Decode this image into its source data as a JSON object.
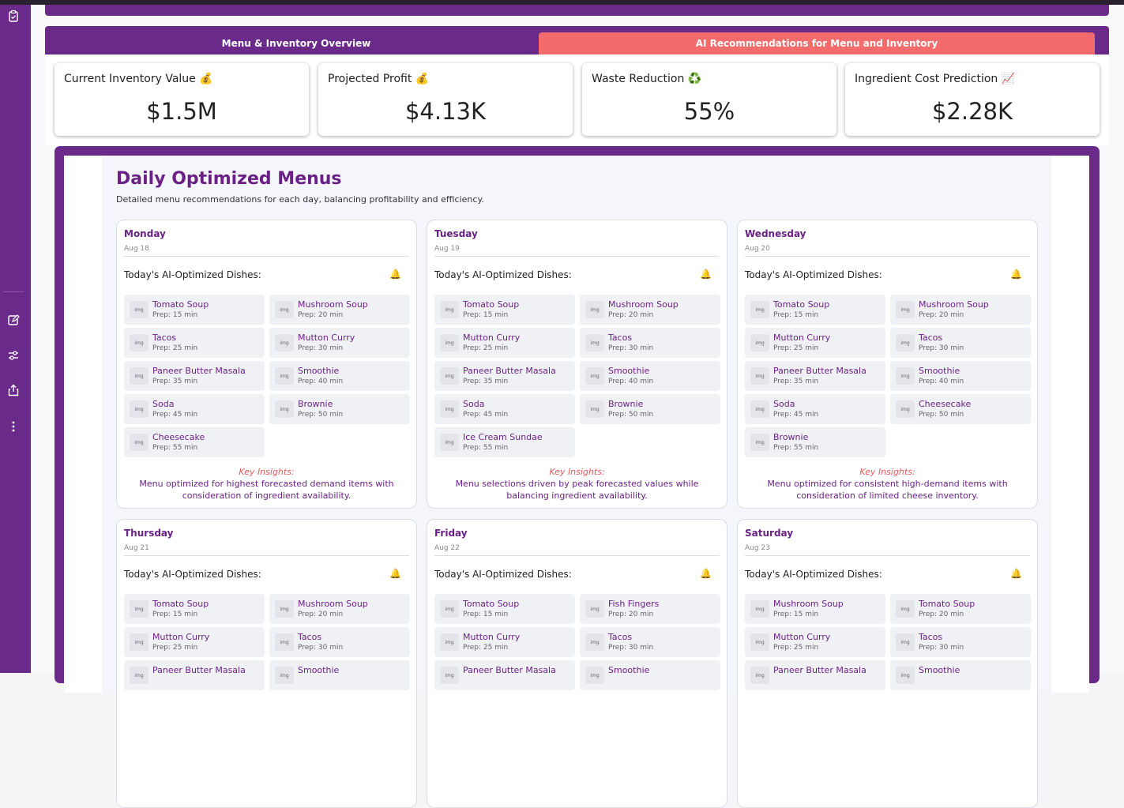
{
  "tabs": [
    {
      "label": "Menu & Inventory Overview"
    },
    {
      "label": "AI Recommendations for Menu and Inventory"
    }
  ],
  "kpis": [
    {
      "title": "Current Inventory Value 💰",
      "value": "$1.5M"
    },
    {
      "title": "Projected Profit 💰",
      "value": "$4.13K"
    },
    {
      "title": "Waste Reduction ♻️",
      "value": "55%"
    },
    {
      "title": "Ingredient Cost Prediction 📈",
      "value": "$2.28K"
    }
  ],
  "section": {
    "title": "Daily Optimized Menus",
    "subtitle": "Detailed menu recommendations for each day, balancing profitability and efficiency.",
    "dishes_heading": "Today's AI-Optimized Dishes:",
    "insights_heading": "Key Insights:",
    "dish_icon": "img",
    "bell_icon": "🔔"
  },
  "days": [
    {
      "day": "Monday",
      "date": "Aug 18",
      "dishes": [
        {
          "name": "Tomato Soup",
          "prep": "Prep: 15 min"
        },
        {
          "name": "Mushroom Soup",
          "prep": "Prep: 20 min"
        },
        {
          "name": "Tacos",
          "prep": "Prep: 25 min"
        },
        {
          "name": "Mutton Curry",
          "prep": "Prep: 30 min"
        },
        {
          "name": "Paneer Butter Masala",
          "prep": "Prep: 35 min"
        },
        {
          "name": "Smoothie",
          "prep": "Prep: 40 min"
        },
        {
          "name": "Soda",
          "prep": "Prep: 45 min"
        },
        {
          "name": "Brownie",
          "prep": "Prep: 50 min"
        },
        {
          "name": "Cheesecake",
          "prep": "Prep: 55 min"
        }
      ],
      "insight": "Menu optimized for highest forecasted demand items with consideration of ingredient availability."
    },
    {
      "day": "Tuesday",
      "date": "Aug 19",
      "dishes": [
        {
          "name": "Tomato Soup",
          "prep": "Prep: 15 min"
        },
        {
          "name": "Mushroom Soup",
          "prep": "Prep: 20 min"
        },
        {
          "name": "Mutton Curry",
          "prep": "Prep: 25 min"
        },
        {
          "name": "Tacos",
          "prep": "Prep: 30 min"
        },
        {
          "name": "Paneer Butter Masala",
          "prep": "Prep: 35 min"
        },
        {
          "name": "Smoothie",
          "prep": "Prep: 40 min"
        },
        {
          "name": "Soda",
          "prep": "Prep: 45 min"
        },
        {
          "name": "Brownie",
          "prep": "Prep: 50 min"
        },
        {
          "name": "Ice Cream Sundae",
          "prep": "Prep: 55 min"
        }
      ],
      "insight": "Menu selections driven by peak forecasted values while balancing ingredient availability."
    },
    {
      "day": "Wednesday",
      "date": "Aug 20",
      "dishes": [
        {
          "name": "Tomato Soup",
          "prep": "Prep: 15 min"
        },
        {
          "name": "Mushroom Soup",
          "prep": "Prep: 20 min"
        },
        {
          "name": "Mutton Curry",
          "prep": "Prep: 25 min"
        },
        {
          "name": "Tacos",
          "prep": "Prep: 30 min"
        },
        {
          "name": "Paneer Butter Masala",
          "prep": "Prep: 35 min"
        },
        {
          "name": "Smoothie",
          "prep": "Prep: 40 min"
        },
        {
          "name": "Soda",
          "prep": "Prep: 45 min"
        },
        {
          "name": "Cheesecake",
          "prep": "Prep: 50 min"
        },
        {
          "name": "Brownie",
          "prep": "Prep: 55 min"
        }
      ],
      "insight": "Menu optimized for consistent high-demand items with consideration of limited cheese inventory."
    },
    {
      "day": "Thursday",
      "date": "Aug 21",
      "dishes": [
        {
          "name": "Tomato Soup",
          "prep": "Prep: 15 min"
        },
        {
          "name": "Mushroom Soup",
          "prep": "Prep: 20 min"
        },
        {
          "name": "Mutton Curry",
          "prep": "Prep: 25 min"
        },
        {
          "name": "Tacos",
          "prep": "Prep: 30 min"
        },
        {
          "name": "Paneer Butter Masala",
          "prep": ""
        },
        {
          "name": "Smoothie",
          "prep": ""
        }
      ],
      "insight": ""
    },
    {
      "day": "Friday",
      "date": "Aug 22",
      "dishes": [
        {
          "name": "Tomato Soup",
          "prep": "Prep: 15 min"
        },
        {
          "name": "Fish Fingers",
          "prep": "Prep: 20 min"
        },
        {
          "name": "Mutton Curry",
          "prep": "Prep: 25 min"
        },
        {
          "name": "Tacos",
          "prep": "Prep: 30 min"
        },
        {
          "name": "Paneer Butter Masala",
          "prep": ""
        },
        {
          "name": "Smoothie",
          "prep": ""
        }
      ],
      "insight": ""
    },
    {
      "day": "Saturday",
      "date": "Aug 23",
      "dishes": [
        {
          "name": "Mushroom Soup",
          "prep": "Prep: 15 min"
        },
        {
          "name": "Tomato Soup",
          "prep": "Prep: 20 min"
        },
        {
          "name": "Mutton Curry",
          "prep": "Prep: 25 min"
        },
        {
          "name": "Tacos",
          "prep": "Prep: 30 min"
        },
        {
          "name": "Paneer Butter Masala",
          "prep": ""
        },
        {
          "name": "Smoothie",
          "prep": ""
        }
      ],
      "insight": ""
    }
  ],
  "sidebar": {
    "icons": [
      "clipboard-icon",
      "edit-icon",
      "sliders-icon",
      "share-icon",
      "more-icon"
    ]
  },
  "colors": {
    "accent": "#6a2a8a",
    "active_tab": "#f46b6b",
    "dish_text": "#6a2185",
    "insight_heading": "#e45a5a"
  }
}
